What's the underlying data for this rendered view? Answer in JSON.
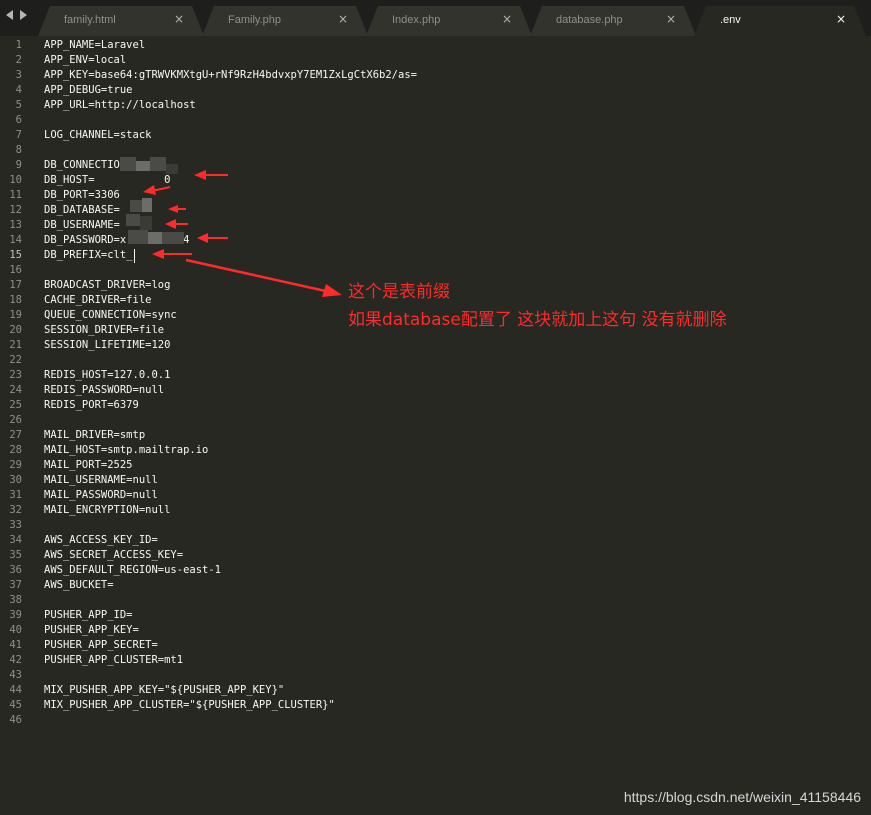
{
  "tabs": [
    {
      "label": "family.html",
      "active": false
    },
    {
      "label": "Family.php",
      "active": false
    },
    {
      "label": "Index.php",
      "active": false
    },
    {
      "label": "database.php",
      "active": false
    },
    {
      "label": ".env",
      "active": true
    }
  ],
  "close_glyph": "×",
  "editor": {
    "current_line": 15,
    "lines": [
      {
        "n": "1",
        "text": "APP_NAME=Laravel"
      },
      {
        "n": "2",
        "text": "APP_ENV=local"
      },
      {
        "n": "3",
        "text": "APP_KEY=base64:gTRWVKMXtgU+rNf9RzH4bdvxpY7EM1ZxLgCtX6b2/as="
      },
      {
        "n": "4",
        "text": "APP_DEBUG=true"
      },
      {
        "n": "5",
        "text": "APP_URL=http://localhost"
      },
      {
        "n": "6",
        "text": ""
      },
      {
        "n": "7",
        "text": "LOG_CHANNEL=stack"
      },
      {
        "n": "8",
        "text": ""
      },
      {
        "n": "9",
        "text": "DB_CONNECTION=mysql"
      },
      {
        "n": "10",
        "text": "DB_HOST=           0"
      },
      {
        "n": "11",
        "text": "DB_PORT=3306"
      },
      {
        "n": "12",
        "text": "DB_DATABASE="
      },
      {
        "n": "13",
        "text": "DB_USERNAME="
      },
      {
        "n": "14",
        "text": "DB_PASSWORD=x         4"
      },
      {
        "n": "15",
        "text": "DB_PREFIX=clt_"
      },
      {
        "n": "16",
        "text": ""
      },
      {
        "n": "17",
        "text": "BROADCAST_DRIVER=log"
      },
      {
        "n": "18",
        "text": "CACHE_DRIVER=file"
      },
      {
        "n": "19",
        "text": "QUEUE_CONNECTION=sync"
      },
      {
        "n": "20",
        "text": "SESSION_DRIVER=file"
      },
      {
        "n": "21",
        "text": "SESSION_LIFETIME=120"
      },
      {
        "n": "22",
        "text": ""
      },
      {
        "n": "23",
        "text": "REDIS_HOST=127.0.0.1"
      },
      {
        "n": "24",
        "text": "REDIS_PASSWORD=null"
      },
      {
        "n": "25",
        "text": "REDIS_PORT=6379"
      },
      {
        "n": "26",
        "text": ""
      },
      {
        "n": "27",
        "text": "MAIL_DRIVER=smtp"
      },
      {
        "n": "28",
        "text": "MAIL_HOST=smtp.mailtrap.io"
      },
      {
        "n": "29",
        "text": "MAIL_PORT=2525"
      },
      {
        "n": "30",
        "text": "MAIL_USERNAME=null"
      },
      {
        "n": "31",
        "text": "MAIL_PASSWORD=null"
      },
      {
        "n": "32",
        "text": "MAIL_ENCRYPTION=null"
      },
      {
        "n": "33",
        "text": ""
      },
      {
        "n": "34",
        "text": "AWS_ACCESS_KEY_ID="
      },
      {
        "n": "35",
        "text": "AWS_SECRET_ACCESS_KEY="
      },
      {
        "n": "36",
        "text": "AWS_DEFAULT_REGION=us-east-1"
      },
      {
        "n": "37",
        "text": "AWS_BUCKET="
      },
      {
        "n": "38",
        "text": ""
      },
      {
        "n": "39",
        "text": "PUSHER_APP_ID="
      },
      {
        "n": "40",
        "text": "PUSHER_APP_KEY="
      },
      {
        "n": "41",
        "text": "PUSHER_APP_SECRET="
      },
      {
        "n": "42",
        "text": "PUSHER_APP_CLUSTER=mt1"
      },
      {
        "n": "43",
        "text": ""
      },
      {
        "n": "44",
        "text": "MIX_PUSHER_APP_KEY=\"${PUSHER_APP_KEY}\""
      },
      {
        "n": "45",
        "text": "MIX_PUSHER_APP_CLUSTER=\"${PUSHER_APP_CLUSTER}\""
      },
      {
        "n": "46",
        "text": ""
      }
    ]
  },
  "annotations": {
    "line1": "这个是表前缀",
    "line2": "如果database配置了 这块就加上这句 没有就删除"
  },
  "watermark": "https://blog.csdn.net/weixin_41158446",
  "colors": {
    "background": "#272822",
    "tabbar": "#1e1f1c",
    "text": "#f8f8f2",
    "annotation": "#ff2a2a"
  }
}
